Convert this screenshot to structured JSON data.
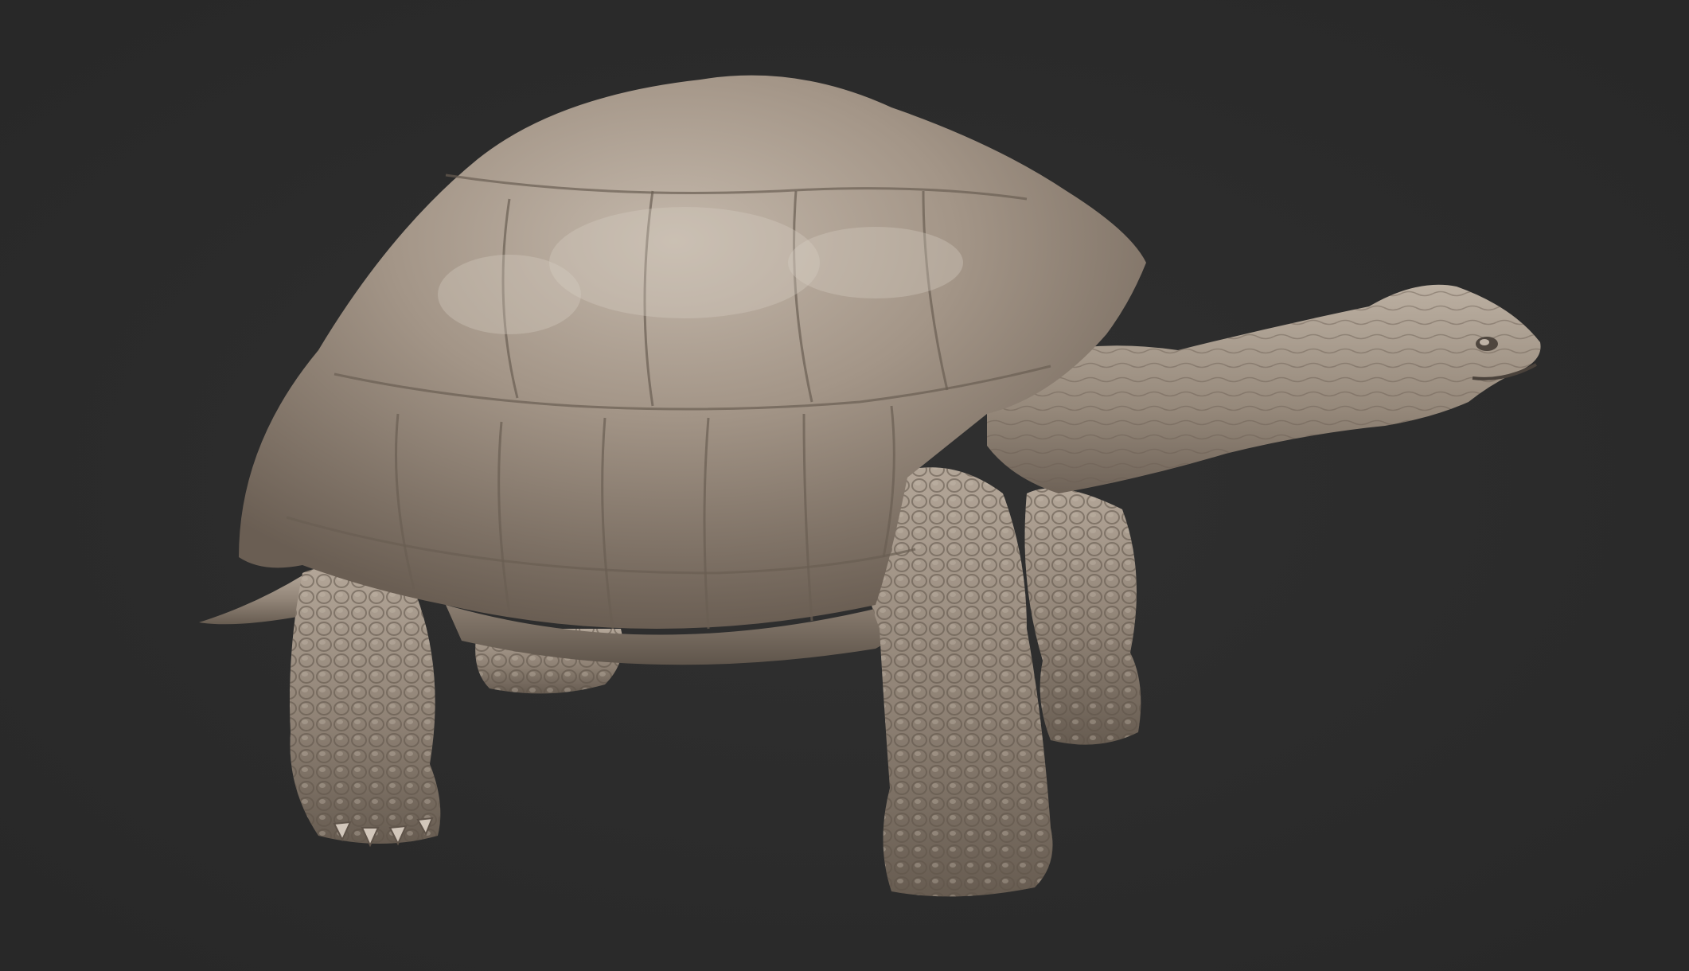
{
  "scene": {
    "background_color": "#2b2b2b",
    "model": {
      "subject": "tortoise",
      "material_color": "#9a8d80",
      "highlight_color": "#c9beb2",
      "shadow_color": "#4a423b"
    }
  }
}
